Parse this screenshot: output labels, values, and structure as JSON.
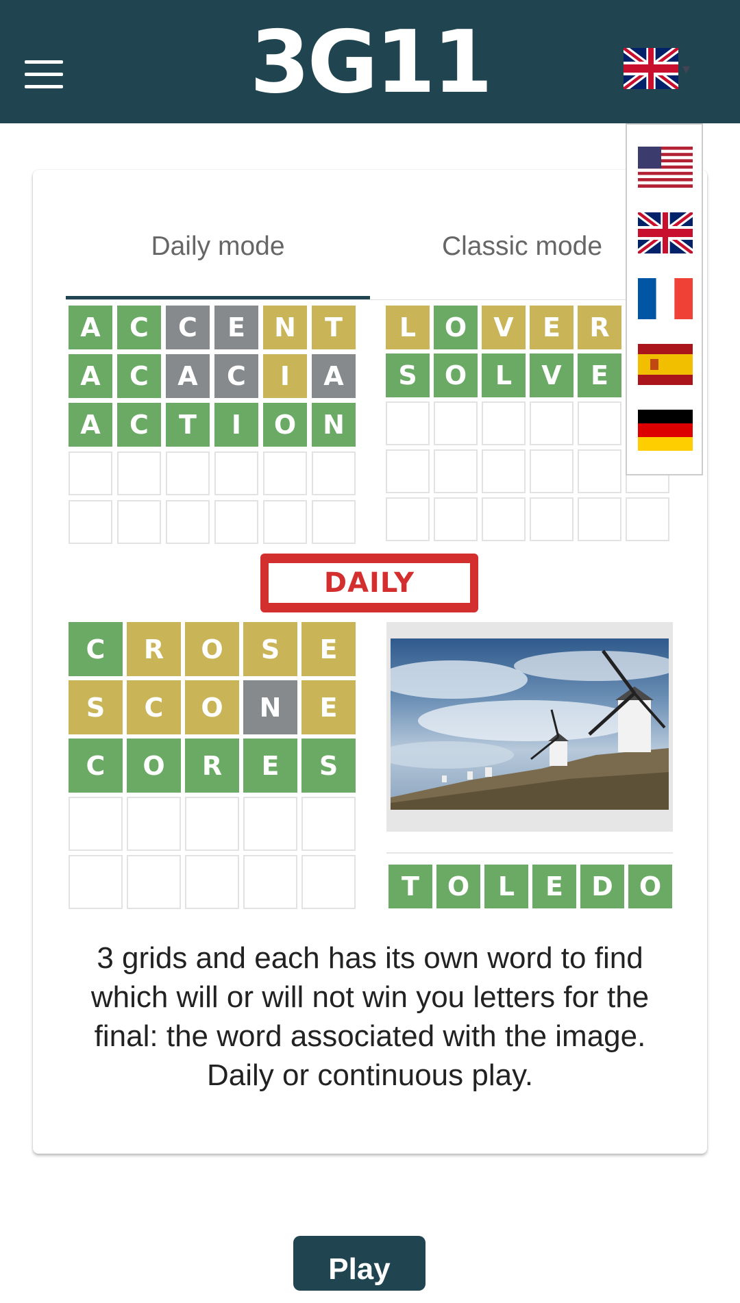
{
  "header": {
    "logo": "3G11",
    "menu_icon": "hamburger-menu-icon",
    "language": "uk-flag-icon"
  },
  "tabs": [
    {
      "label": "Daily mode",
      "active": true
    },
    {
      "label": "Classic mode",
      "active": false
    }
  ],
  "grids": [
    {
      "rows": [
        [
          "A",
          "C",
          "C",
          "E",
          "N",
          "T"
        ],
        [
          "A",
          "C",
          "A",
          "C",
          "I",
          "A"
        ],
        [
          "A",
          "C",
          "T",
          "I",
          "O",
          "N"
        ],
        [
          "",
          "",
          "",
          "",
          "",
          ""
        ],
        [
          "",
          "",
          "",
          "",
          "",
          ""
        ]
      ],
      "states": [
        [
          "g",
          "g",
          "x",
          "x",
          "y",
          "y"
        ],
        [
          "g",
          "g",
          "x",
          "x",
          "y",
          "x"
        ],
        [
          "g",
          "g",
          "g",
          "g",
          "g",
          "g"
        ],
        [
          "e",
          "e",
          "e",
          "e",
          "e",
          "e"
        ],
        [
          "e",
          "e",
          "e",
          "e",
          "e",
          "e"
        ]
      ]
    },
    {
      "rows": [
        [
          "L",
          "O",
          "V",
          "E",
          "R",
          ""
        ],
        [
          "S",
          "O",
          "L",
          "V",
          "E",
          ""
        ],
        [
          "",
          "",
          "",
          "",
          "",
          ""
        ],
        [
          "",
          "",
          "",
          "",
          "",
          ""
        ],
        [
          "",
          "",
          "",
          "",
          "",
          ""
        ]
      ],
      "states": [
        [
          "y",
          "g",
          "y",
          "y",
          "y",
          "e"
        ],
        [
          "g",
          "g",
          "g",
          "g",
          "g",
          "e"
        ],
        [
          "e",
          "e",
          "e",
          "e",
          "e",
          "e"
        ],
        [
          "e",
          "e",
          "e",
          "e",
          "e",
          "e"
        ],
        [
          "e",
          "e",
          "e",
          "e",
          "e",
          "e"
        ]
      ]
    },
    {
      "rows": [
        [
          "C",
          "R",
          "O",
          "S",
          "E"
        ],
        [
          "S",
          "C",
          "O",
          "N",
          "E"
        ],
        [
          "C",
          "O",
          "R",
          "E",
          "S"
        ],
        [
          "",
          "",
          "",
          "",
          ""
        ],
        [
          "",
          "",
          "",
          "",
          ""
        ]
      ],
      "states": [
        [
          "g",
          "y",
          "y",
          "y",
          "y"
        ],
        [
          "y",
          "y",
          "y",
          "x",
          "y"
        ],
        [
          "g",
          "g",
          "g",
          "g",
          "g"
        ],
        [
          "e",
          "e",
          "e",
          "e",
          "e"
        ],
        [
          "e",
          "e",
          "e",
          "e",
          "e"
        ]
      ]
    }
  ],
  "stamp": "DAILY",
  "image": {
    "description": "windmills-photo"
  },
  "answer": {
    "letters": [
      "T",
      "O",
      "L",
      "E",
      "D",
      "O"
    ]
  },
  "description": "3 grids and each has its own word to find which will or will not win you letters for the final: the word associated with the image. Daily or continuous play.",
  "languages": [
    {
      "code": "us",
      "icon": "us-flag-icon"
    },
    {
      "code": "uk",
      "icon": "uk-flag-icon"
    },
    {
      "code": "fr",
      "icon": "france-flag-icon"
    },
    {
      "code": "es",
      "icon": "spain-flag-icon"
    },
    {
      "code": "de",
      "icon": "germany-flag-icon"
    }
  ],
  "play_label": "Play",
  "colors": {
    "header": "#204550",
    "green": "#6aaa64",
    "yellow": "#c9b458",
    "gray": "#878a8c",
    "stamp": "#d32f2f"
  }
}
